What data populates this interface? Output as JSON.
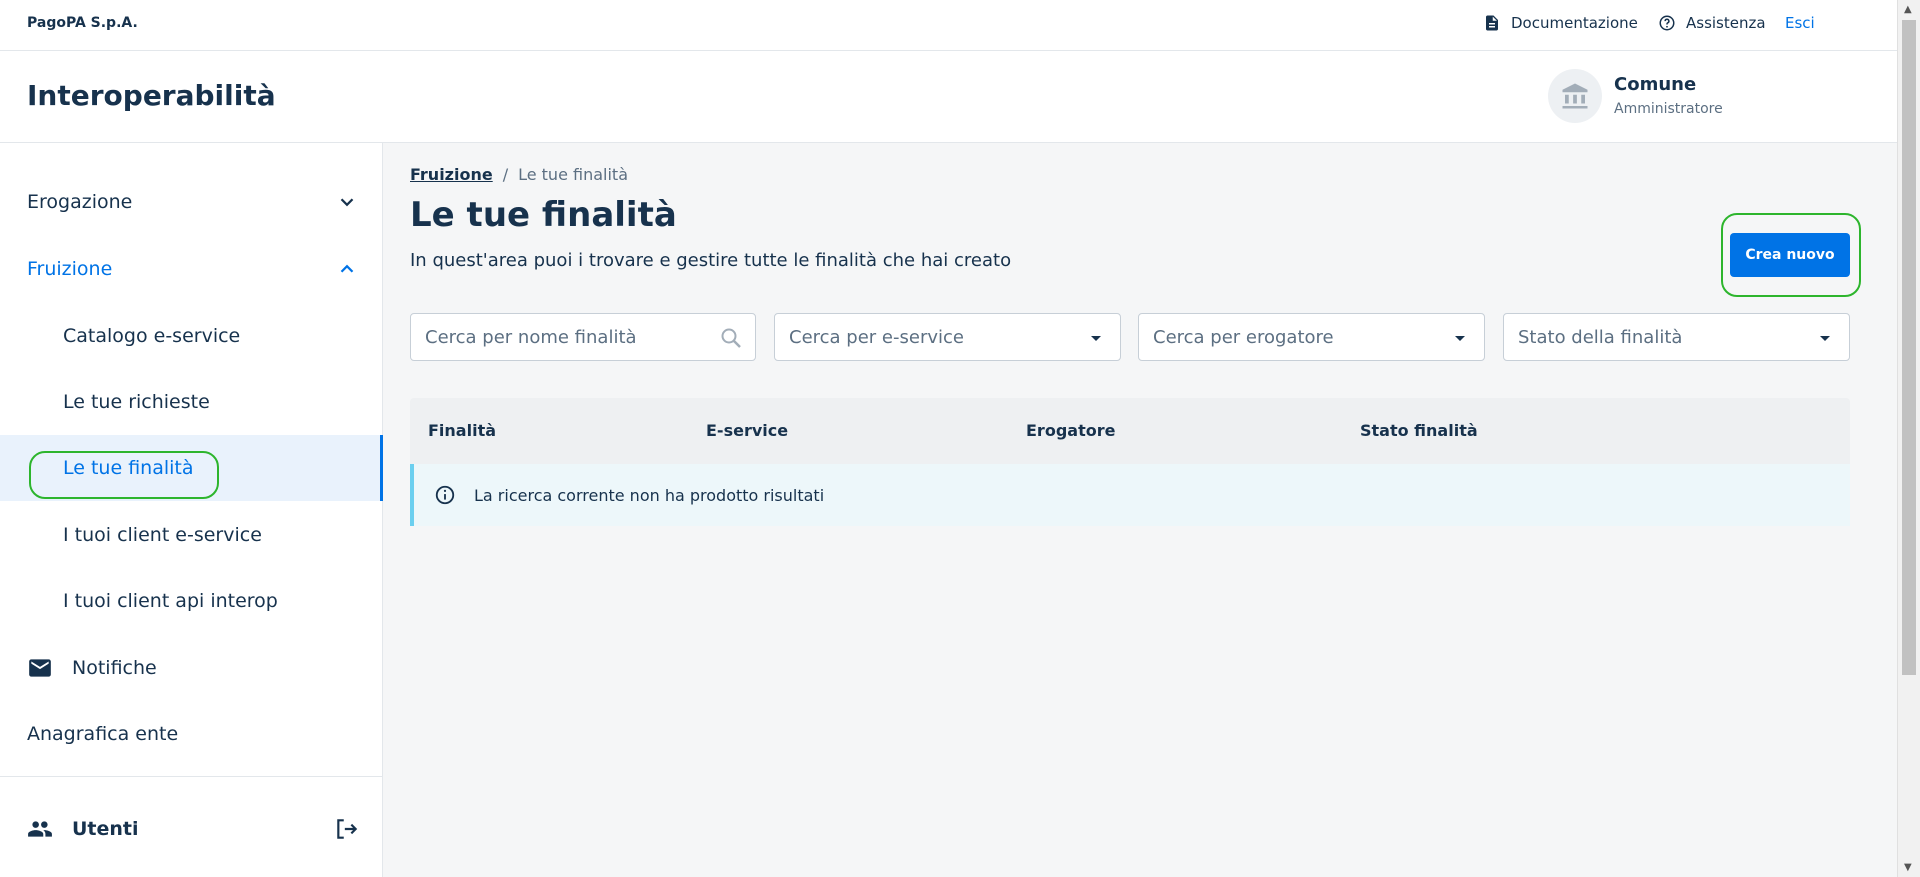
{
  "topbar": {
    "brand": "PagoPA S.p.A.",
    "documentation": "Documentazione",
    "assistance": "Assistenza",
    "logout": "Esci"
  },
  "subheader": {
    "product": "Interoperabilità",
    "party_name": "Comune",
    "party_role": "Amministratore"
  },
  "sidebar": {
    "erogazione": "Erogazione",
    "fruizione": "Fruizione",
    "sub_items": [
      "Catalogo e-service",
      "Le tue richieste",
      "Le tue finalità",
      "I tuoi client e-service",
      "I tuoi client api interop"
    ],
    "notifiche": "Notifiche",
    "anagrafica": "Anagrafica ente",
    "utenti": "Utenti"
  },
  "main": {
    "breadcrumb_parent": "Fruizione",
    "breadcrumb_separator": "/",
    "breadcrumb_current": "Le tue finalità",
    "title": "Le tue finalità",
    "description": "In quest'area puoi i trovare e gestire tutte le finalità che hai creato",
    "create_button": "Crea nuovo",
    "filters": {
      "search_name_placeholder": "Cerca per nome finalità",
      "eservice": "Cerca per e-service",
      "provider": "Cerca per erogatore",
      "status": "Stato della finalità"
    },
    "table": {
      "columns": [
        "Finalità",
        "E-service",
        "Erogatore",
        "Stato finalità"
      ],
      "empty_message": "La ricerca corrente non ha prodotto risultati"
    }
  },
  "colors": {
    "primary": "#0073e6",
    "text": "#17324d",
    "highlight": "#2db52d"
  }
}
